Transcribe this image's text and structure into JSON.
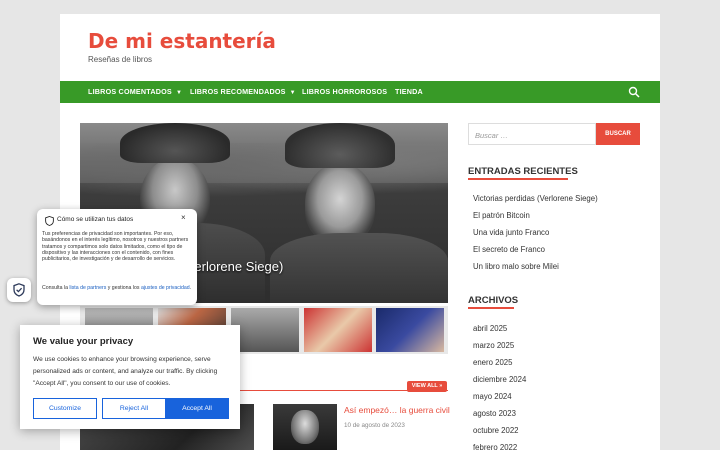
{
  "site": {
    "title": "De mi estantería",
    "description": "Reseñas de libros"
  },
  "nav": {
    "items": [
      {
        "label": "LIBROS COMENTADOS",
        "dropdown": true
      },
      {
        "label": "LIBROS RECOMENDADOS",
        "dropdown": true
      },
      {
        "label": "LIBROS HORROROSOS",
        "dropdown": false
      },
      {
        "label": "TIENDA",
        "dropdown": false
      }
    ],
    "search_icon": "search-icon"
  },
  "hero": {
    "caption": "s (Verlorene Siege)"
  },
  "featured": {
    "view_all_label": "VIEW ALL »",
    "post_title": "Así empezó… la guerra civil",
    "post_date": "10 de agosto de 2023"
  },
  "sidebar": {
    "search_placeholder": "Buscar …",
    "search_button": "BUSCAR",
    "recent_title": "ENTRADAS RECIENTES",
    "recent_posts": [
      "Victorias perdidas (Verlorene Siege)",
      "El patrón Bitcoin",
      "Una vida junto Franco",
      "El secreto de Franco",
      "Un libro malo sobre Milei"
    ],
    "archives_title": "ARCHIVOS",
    "archives": [
      "abril 2025",
      "marzo 2025",
      "enero 2025",
      "diciembre 2024",
      "mayo 2024",
      "agosto 2023",
      "octubre 2022",
      "febrero 2022"
    ]
  },
  "privacy_popup": {
    "title": "Cómo se utilizan tus datos",
    "close": "×",
    "body": "Tus preferencias de privacidad son importantes. Por eso, basándonos en el interés legítimo, nosotros y nuestros partners tratamos y compartimos solo datos limitados, como el tipo de dispositivo y las interacciones con el contenido, con fines publicitarios, de investigación y de desarrollo de servicios.",
    "consult_prefix": "Consulta la ",
    "partners_link": "lista de partners",
    "consult_middle": " y gestiona los ",
    "settings_link": "ajustes de privacidad",
    "consult_suffix": "."
  },
  "cookie_banner": {
    "title": "We value your privacy",
    "text": "We use cookies to enhance your browsing experience, serve personalized ads or content, and analyze our traffic. By clicking \"Accept All\", you consent to our use of cookies.",
    "customize": "Customize",
    "reject": "Reject All",
    "accept": "Accept All"
  },
  "colors": {
    "brand_red": "#e74c3c",
    "nav_green": "#389a27",
    "cookie_blue": "#1863dc"
  }
}
